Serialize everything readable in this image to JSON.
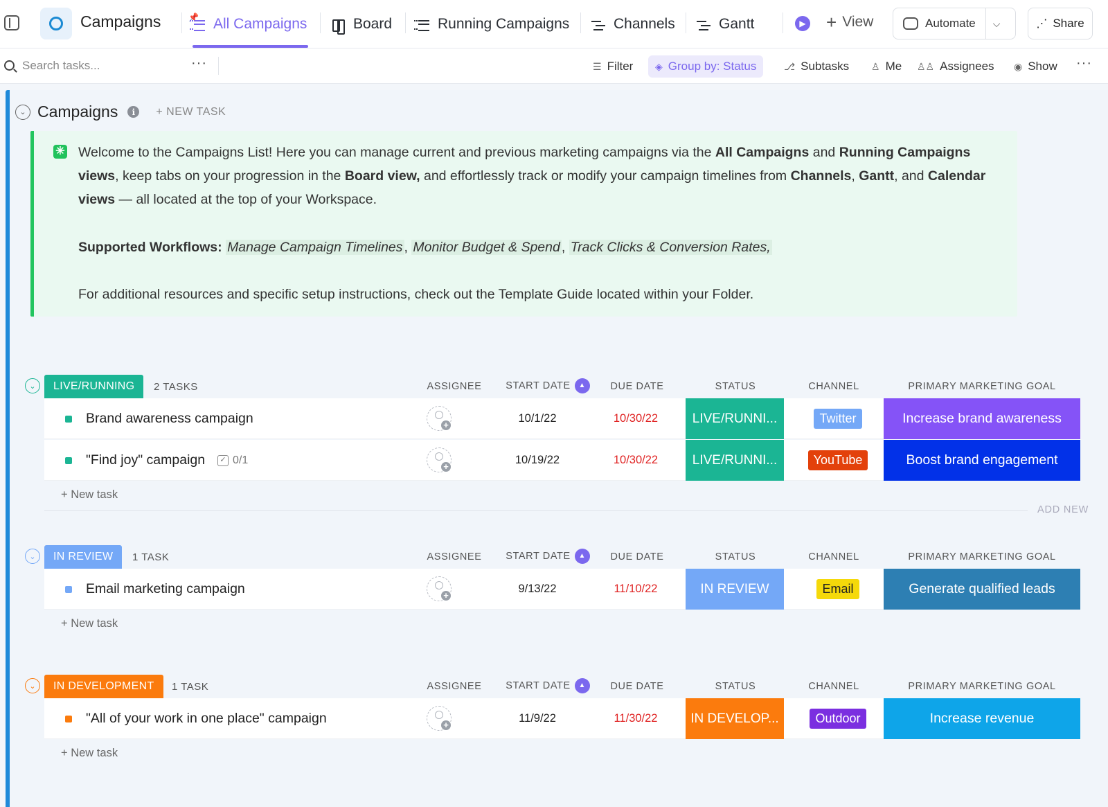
{
  "space": {
    "title": "Campaigns"
  },
  "tabs": [
    {
      "label": "All Campaigns",
      "active": true
    },
    {
      "label": "Board"
    },
    {
      "label": "Running Campaigns"
    },
    {
      "label": "Channels"
    },
    {
      "label": "Gantt"
    }
  ],
  "header_actions": {
    "add_view": "View",
    "automate": "Automate",
    "share": "Share"
  },
  "toolbar": {
    "search_placeholder": "Search tasks...",
    "filter": "Filter",
    "group_by": "Group by: Status",
    "subtasks": "Subtasks",
    "me": "Me",
    "assignees": "Assignees",
    "show": "Show"
  },
  "list": {
    "title": "Campaigns",
    "new_task": "+ NEW TASK"
  },
  "welcome": {
    "p1_a": "Welcome to the Campaigns List! Here you can manage current and previous marketing campaigns via the ",
    "p1_b": "All Campaigns",
    "p1_c": " and ",
    "p1_d": "Running Campaigns views",
    "p1_e": ", keep tabs on your progression in the ",
    "p1_f": "Board view,",
    "p1_g": " and effortlessly track or modify your campaign timelines from ",
    "p1_h": "Channels",
    "p1_i": ", ",
    "p1_j": "Gantt",
    "p1_k": ", and ",
    "p1_l": "Calendar views",
    "p1_m": " — all located at the top of your Workspace.",
    "wf_label": "Supported Workflows:",
    "wf1": "Manage Campaign Timelines",
    "wf2": "Monitor Budget & Spend",
    "wf3": "Track Clicks & Conversion Rates,",
    "p3": "For additional resources and specific setup instructions, check out the Template Guide located within your Folder."
  },
  "columns": {
    "assignee": "ASSIGNEE",
    "start_date": "START DATE",
    "due_date": "DUE DATE",
    "status": "STATUS",
    "channel": "CHANNEL",
    "goal": "PRIMARY MARKETING GOAL"
  },
  "new_task_label": "+ New task",
  "add_new": "ADD NEW",
  "groups": [
    {
      "name": "LIVE/RUNNING",
      "count": "2 TASKS",
      "color": "#1bb594",
      "tasks": [
        {
          "name": "Brand awareness campaign",
          "start": "10/1/22",
          "due": "10/30/22",
          "status": "LIVE/RUNNI...",
          "channel": "Twitter",
          "channel_color": "#74a8f7",
          "goal": "Increase brand awareness",
          "goal_color": "#8553f7"
        },
        {
          "name": "\"Find joy\" campaign",
          "subtasks": "0/1",
          "start": "10/19/22",
          "due": "10/30/22",
          "status": "LIVE/RUNNI...",
          "channel": "YouTube",
          "channel_color": "#e3410b",
          "goal": "Boost brand engagement",
          "goal_color": "#0231e8"
        }
      ]
    },
    {
      "name": "IN REVIEW",
      "count": "1 TASK",
      "color": "#74a8f7",
      "tasks": [
        {
          "name": "Email marketing campaign",
          "start": "9/13/22",
          "due": "11/10/22",
          "status": "IN REVIEW",
          "channel": "Email",
          "channel_color": "#f5d90a",
          "goal": "Generate qualified leads",
          "goal_color": "#2d7fb3"
        }
      ]
    },
    {
      "name": "IN DEVELOPMENT",
      "count": "1 TASK",
      "color": "#fb7b0d",
      "tasks": [
        {
          "name": "\"All of your work in one place\" campaign",
          "start": "11/9/22",
          "due": "11/30/22",
          "status": "IN DEVELOP...",
          "channel": "Outdoor",
          "channel_color": "#7b2fe0",
          "goal": "Increase revenue",
          "goal_color": "#0ea5e9"
        }
      ]
    }
  ]
}
